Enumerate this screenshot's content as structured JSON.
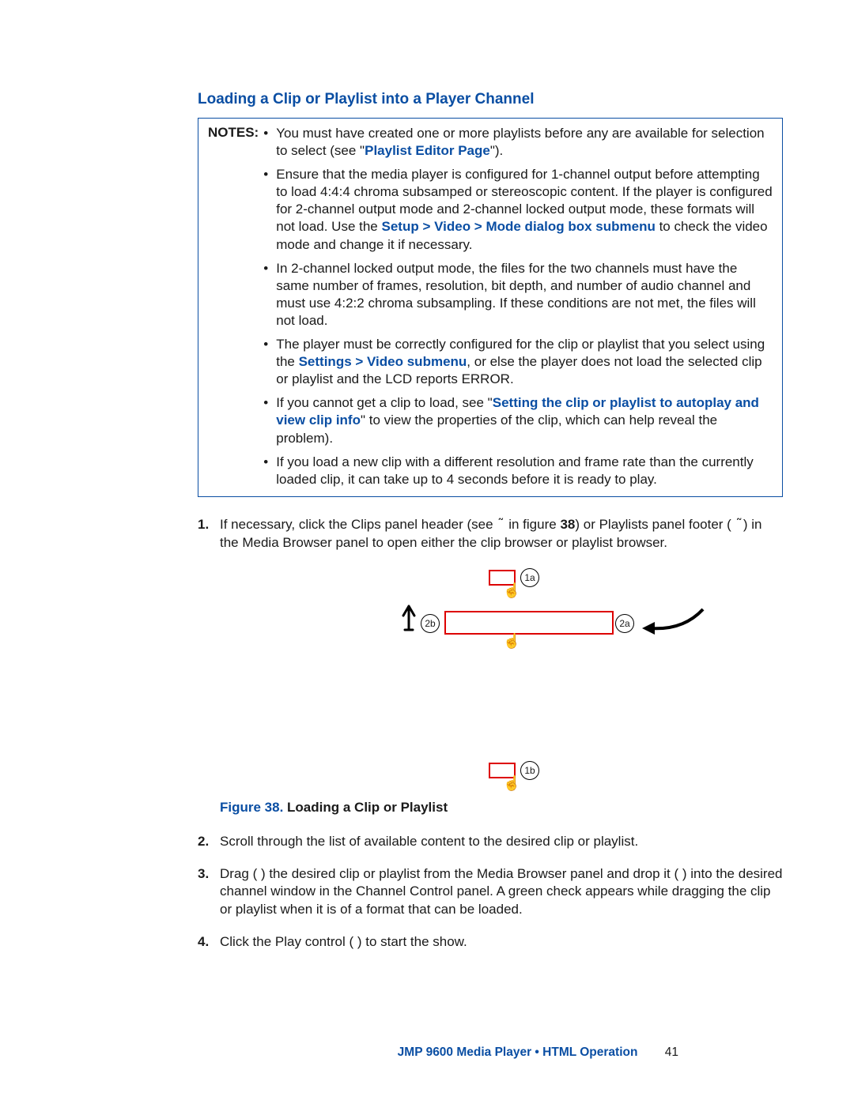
{
  "title": "Loading a Clip or Playlist into a Player Channel",
  "notes_label": "NOTES:",
  "notes": {
    "n1a": "You must have created one or more playlists before any are available for selection to select (see \"",
    "n1b": "Playlist Editor Page",
    "n1c": "\").",
    "n2a": "Ensure that the media player is configured for 1-channel output before attempting to load 4:4:4 chroma subsamped or stereoscopic content. If the player is configured for 2-channel output mode and 2-channel locked output mode, these formats will not load. Use the ",
    "n2b": "Setup > Video > Mode dialog box submenu",
    "n2c": " to check the video mode and change it if necessary.",
    "n3": "In 2-channel locked output mode, the files for the two channels must have the same number of frames, resolution, bit depth, and number of audio channel and must use 4:2:2 chroma subsampling. If these conditions are not met, the files will not load.",
    "n4a": "The player must be correctly configured for the clip or playlist that you select using the ",
    "n4b": "Settings > Video submenu",
    "n4c": ", or else the player does not load the selected clip or playlist and the LCD reports ERROR.",
    "n5a": "If you cannot get a clip to load, see \"",
    "n5b": "Setting the clip or playlist to autoplay and view clip info",
    "n5c": "\" to view the properties of the clip, which can help reveal the problem).",
    "n6": "If you load a new clip with a different resolution and frame rate than the currently loaded clip, it can take up to 4 seconds before it is ready to play."
  },
  "steps": {
    "s1_num": "1.",
    "s1a": "If necessary, click the Clips panel header (see ",
    "s1b": " in figure ",
    "s1c": "38",
    "s1d": ") or Playlists panel footer ( ",
    "s1e": ") in the Media Browser panel to open either the clip browser or playlist browser.",
    "s2_num": "2.",
    "s2": "Scroll through the list of available content to the desired clip or playlist.",
    "s3_num": "3.",
    "s3": "Drag (   ) the desired clip or playlist from the Media Browser panel and drop it (   ) into the desired channel window in the Channel Control panel. A green check appears while dragging the clip or playlist when it is of a format that can be loaded.",
    "s4_num": "4.",
    "s4": "Click the Play control (   ) to start the show."
  },
  "callouts": {
    "c1a": "1a",
    "c2a": "2a",
    "c2b": "2b",
    "c1b": "1b"
  },
  "figure_caption_a": "Figure 38.",
  "figure_caption_b": " Loading a Clip or Playlist",
  "footer_text": "JMP 9600 Media Player • HTML Operation",
  "footer_page": "41"
}
